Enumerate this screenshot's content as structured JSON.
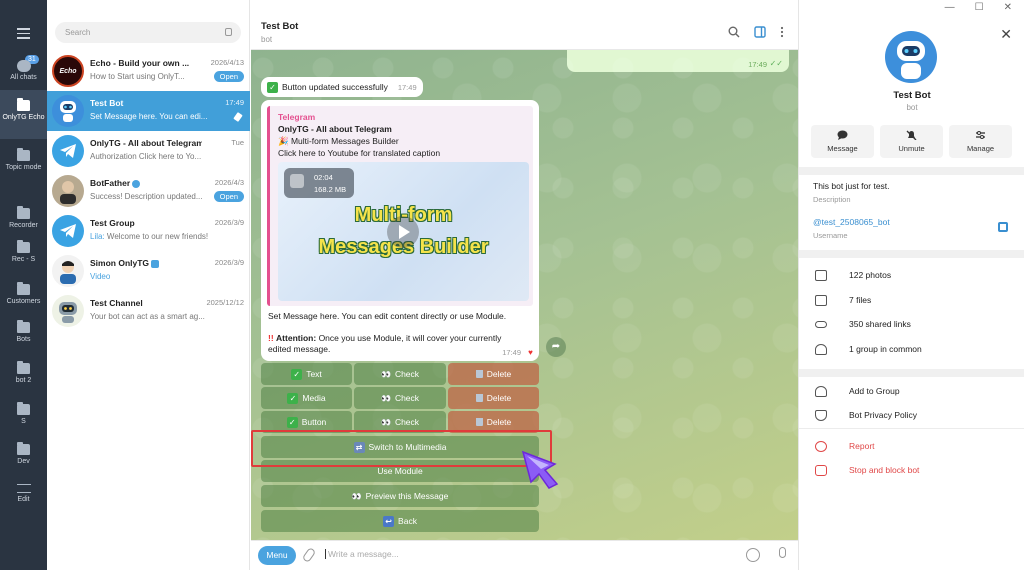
{
  "window": {
    "minimize": "—",
    "maximize": "☐",
    "close": "✕"
  },
  "folders": {
    "all_chats_badge": "31",
    "items": [
      {
        "label": "All chats"
      },
      {
        "label": "OnlyTG Echo"
      },
      {
        "label": "Topic mode"
      },
      {
        "label": "Recorder"
      },
      {
        "label": "Rec - S"
      },
      {
        "label": "Customers"
      },
      {
        "label": "Bots"
      },
      {
        "label": "bot 2"
      },
      {
        "label": "S"
      },
      {
        "label": "Dev"
      },
      {
        "label": "Edit"
      }
    ]
  },
  "search": {
    "placeholder": "Search"
  },
  "chats": [
    {
      "name": "Echo - Build your own ...",
      "date": "2026/4/13",
      "preview": "How to Start using OnlyT...",
      "pill": "Open",
      "avatar_text": "Echo"
    },
    {
      "name": "Test Bot",
      "date": "17:49",
      "preview": "Set Message here. You can edi..."
    },
    {
      "name": "OnlyTG - All about Telegram",
      "date": "Tue",
      "preview": "Authorization Click here to Yo..."
    },
    {
      "name": "BotFather",
      "date": "2026/4/3",
      "preview": "Success! Description updated...",
      "pill": "Open"
    },
    {
      "name": "Test Group",
      "date": "2026/3/9",
      "preview_sender": "Lila:",
      "preview": "Welcome to our new friends!"
    },
    {
      "name": "Simon OnlyTG",
      "date": "2026/3/9",
      "preview": "Video"
    },
    {
      "name": "Test Channel",
      "date": "2025/12/12",
      "preview": "Your bot can act as a smart ag..."
    }
  ],
  "conversation": {
    "title": "Test Bot",
    "subtitle": "bot",
    "out_time": "17:49",
    "notice": {
      "text": "Button updated successfully",
      "time": "17:49"
    },
    "message": {
      "site": "Telegram",
      "title": "OnlyTG - All about Telegram",
      "line1": "Multi-form Messages Builder",
      "line2": "Click here to Youtube for translated caption",
      "video": {
        "duration": "02:04",
        "size": "168.2 MB",
        "title_line1": "Multi-form",
        "title_line2": "Messages Builder"
      },
      "body": "Set Message here. You can edit content directly or use Module.",
      "attention_label": "Attention:",
      "attention_text": "Once you use Module, it will cover your currently edited message.",
      "time": "17:49"
    },
    "keyboard": {
      "rows": [
        {
          "toggle": "Text",
          "check": "Check",
          "delete": "Delete"
        },
        {
          "toggle": "Media",
          "check": "Check",
          "delete": "Delete"
        },
        {
          "toggle": "Button",
          "check": "Check",
          "delete": "Delete"
        }
      ],
      "switch": "Switch to Multimedia",
      "use_module": "Use Module",
      "preview": "Preview this Message",
      "back": "Back"
    },
    "composer": {
      "menu": "Menu",
      "placeholder": "Write a message..."
    }
  },
  "profile": {
    "name": "Test Bot",
    "sub": "bot",
    "actions": [
      "Message",
      "Unmute",
      "Manage"
    ],
    "about": "This bot just for test.",
    "about_label": "Description",
    "username": "@test_2508065_bot",
    "username_label": "Username",
    "stats": [
      "122 photos",
      "7 files",
      "350 shared links",
      "1 group in common"
    ],
    "options": [
      "Add to Group",
      "Bot Privacy Policy"
    ],
    "danger": [
      "Report",
      "Stop and block bot"
    ]
  },
  "colors": {
    "accent": "#419fd9",
    "sidebar": "#2a3441",
    "danger": "#e04848",
    "highlight": "#e03b3b"
  }
}
